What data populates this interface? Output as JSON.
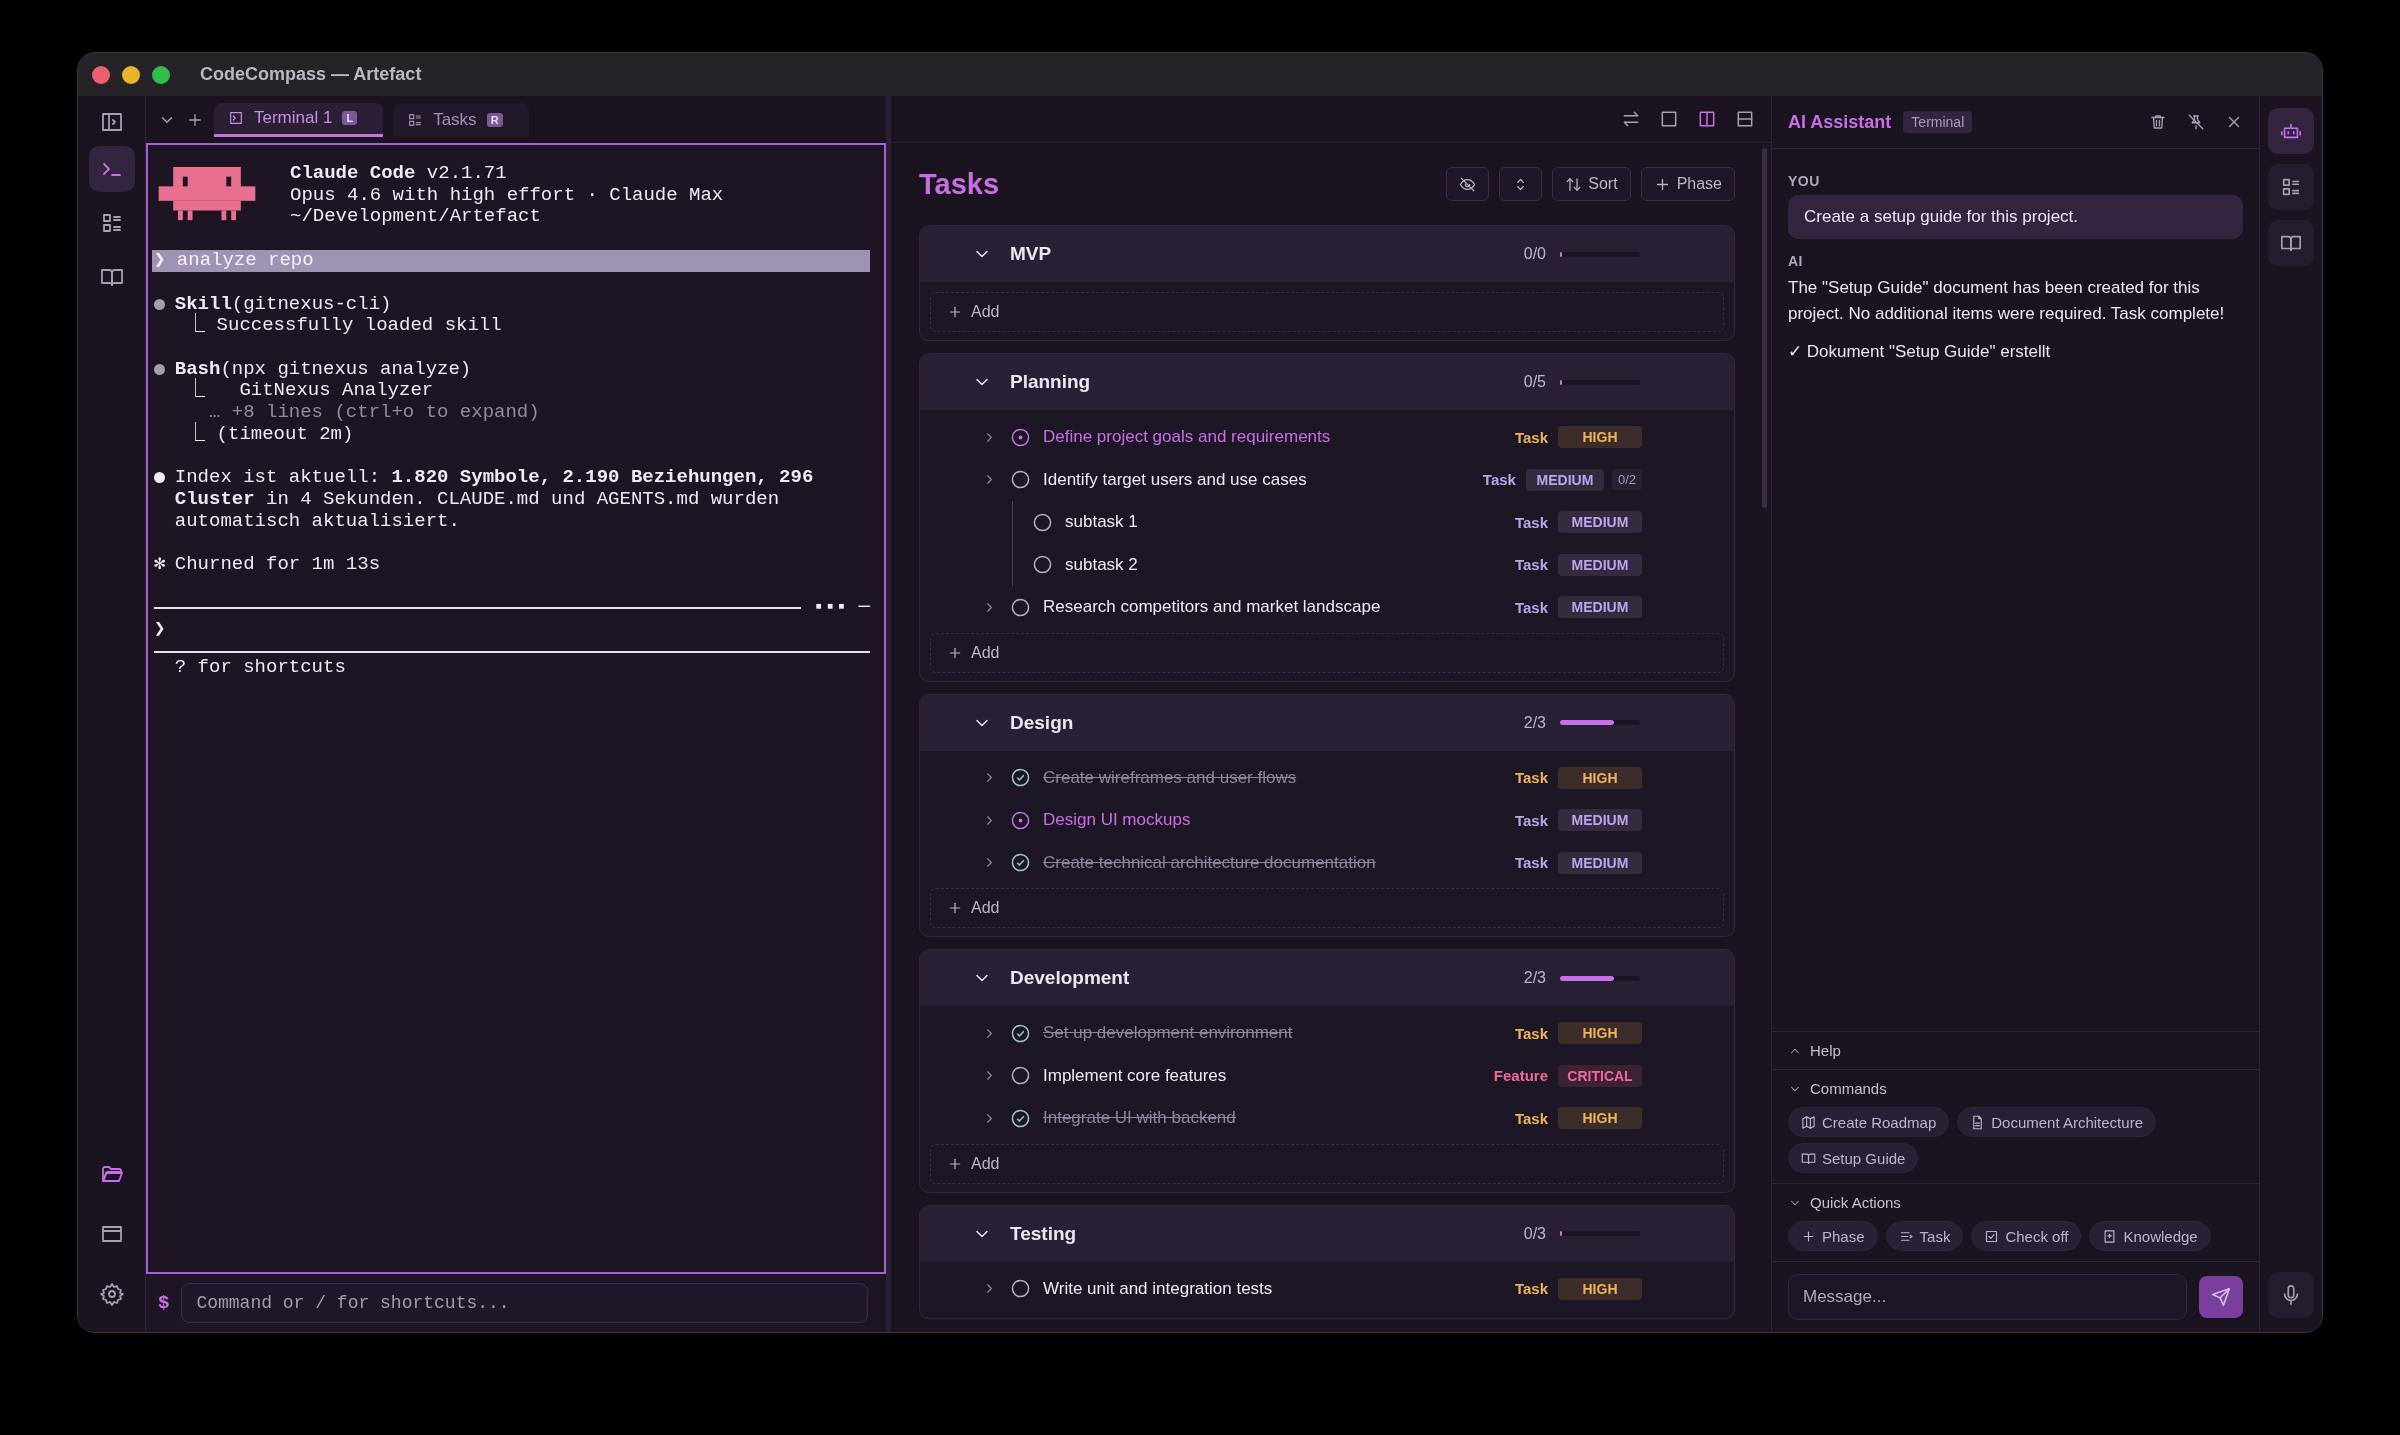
{
  "window": {
    "title": "CodeCompass — Artefact"
  },
  "left_rail": {
    "top": [
      {
        "kind": "terminal",
        "selected": true
      },
      {
        "kind": "list",
        "selected": false
      },
      {
        "kind": "book",
        "selected": false
      }
    ],
    "bottom": [
      {
        "kind": "folder",
        "active": true
      },
      {
        "kind": "window",
        "active": false
      },
      {
        "kind": "settings",
        "active": false
      }
    ]
  },
  "tabs": [
    {
      "kind": "terminal",
      "label": "Terminal 1",
      "badge": "L",
      "selected": true
    },
    {
      "kind": "list",
      "label": "Tasks",
      "badge": "R",
      "selected": false
    }
  ],
  "layout_buttons": [
    {
      "kind": "swap",
      "selected": false
    },
    {
      "kind": "single",
      "selected": false
    },
    {
      "kind": "split",
      "selected": true
    },
    {
      "kind": "rows",
      "selected": false
    }
  ],
  "terminal": {
    "app": "Claude Code",
    "version": "v2.1.71",
    "model": "Opus 4.6 with high effort · Claude Max",
    "path": "~/Development/Artefact",
    "prompt": "❯ analyze repo",
    "blocks": [
      {
        "kind": "bullet",
        "color": "#a39ead",
        "head": "**Skill**(gitnexus-cli)",
        "lines": [
          {
            "kind": "result",
            "text": "⎿ Successfully loaded skill"
          }
        ]
      },
      {
        "kind": "bullet",
        "color": "#a39ead",
        "head": "**Bash**(npx gitnexus analyze)",
        "lines": [
          {
            "kind": "result",
            "text": "⎿   GitNexus Analyzer"
          },
          {
            "kind": "dim",
            "text": "… +8 lines (ctrl+o to expand)"
          },
          {
            "kind": "result",
            "text": "⎿ (timeout 2m)"
          }
        ]
      },
      {
        "kind": "bullet",
        "color": "#f2eef6",
        "head": "Index ist aktuell: **1.820 Symbole, 2.190 Beziehungen, 296 Cluster** in 4 Sekunden. CLAUDE.md und AGENTS.md wurden automatisch aktualisiert."
      },
      {
        "kind": "star",
        "marker": "✻",
        "head": "Churned for 1m 13s"
      }
    ],
    "rule_marker": "▪▪▪ ─",
    "input_caret": "❯",
    "hint": "? for shortcuts"
  },
  "command": {
    "prefix": "$",
    "placeholder": "Command or / for shortcuts..."
  },
  "tasks": {
    "title": "Tasks",
    "toolbar": [
      {
        "kind": "hide"
      },
      {
        "kind": "collapse"
      },
      {
        "kind": "sort",
        "label": "Sort"
      },
      {
        "kind": "add",
        "label": "Phase"
      }
    ],
    "phases": [
      {
        "name": "MVP",
        "count": "0/0",
        "level": 0,
        "expanded": true,
        "add_label": "Add"
      },
      {
        "name": "Planning",
        "count": "0/5",
        "level": 0,
        "expanded": true,
        "add_label": "Add",
        "tasks": [
          {
            "title": "Define project goals and requirements",
            "active": true,
            "done": false,
            "type": "Task",
            "priority": "HIGH",
            "color": "#f0b35a"
          },
          {
            "title": "Identify target users and use cases",
            "active": false,
            "done": false,
            "type": "Task",
            "priority": "MEDIUM",
            "color": "#b9a6ea",
            "subcount": "0/2",
            "children": [
              {
                "title": "subtask 1",
                "active": false,
                "done": false,
                "type": "Task",
                "priority": "MEDIUM",
                "color": "#b9a6ea"
              },
              {
                "title": "subtask 2",
                "active": false,
                "done": false,
                "type": "Task",
                "priority": "MEDIUM",
                "color": "#b9a6ea"
              }
            ]
          },
          {
            "title": "Research competitors and market landscape",
            "active": false,
            "done": false,
            "type": "Task",
            "priority": "MEDIUM",
            "color": "#b9a6ea"
          }
        ]
      },
      {
        "name": "Design",
        "count": "2/3",
        "level": 0.67,
        "expanded": true,
        "add_label": "Add",
        "tasks": [
          {
            "title": "Create wireframes and user flows",
            "active": false,
            "done": true,
            "type": "Task",
            "priority": "HIGH",
            "color": "#f0b35a"
          },
          {
            "title": "Design UI mockups",
            "active": true,
            "done": false,
            "type": "Task",
            "priority": "MEDIUM",
            "color": "#b9a6ea"
          },
          {
            "title": "Create technical architecture documentation",
            "active": false,
            "done": true,
            "type": "Task",
            "priority": "MEDIUM",
            "color": "#b9a6ea"
          }
        ]
      },
      {
        "name": "Development",
        "count": "2/3",
        "level": 0.67,
        "expanded": true,
        "add_label": "Add",
        "tasks": [
          {
            "title": "Set up development environment",
            "active": false,
            "done": true,
            "type": "Task",
            "priority": "HIGH",
            "color": "#f0b35a"
          },
          {
            "title": "Implement core features",
            "active": false,
            "done": false,
            "type": "Feature",
            "priority": "CRITICAL",
            "color": "#ef6b93"
          },
          {
            "title": "Integrate UI with backend",
            "active": false,
            "done": true,
            "type": "Task",
            "priority": "HIGH",
            "color": "#f0b35a"
          }
        ]
      },
      {
        "name": "Testing",
        "count": "0/3",
        "level": 0,
        "expanded": true,
        "tasks": [
          {
            "title": "Write unit and integration tests",
            "active": false,
            "done": false,
            "type": "Task",
            "priority": "HIGH",
            "color": "#f0b35a"
          }
        ]
      }
    ]
  },
  "assistant": {
    "title": "AI Assistant",
    "badge": "Terminal",
    "messages": [
      {
        "kind": "user",
        "role": "YOU",
        "text": "Create a setup guide for this project."
      },
      {
        "kind": "ai",
        "role": "AI",
        "text": "The \"Setup Guide\" document has been created for this project. No additional items were required. Task complete!",
        "notes": [
          "✓ Dokument \"Setup Guide\" erstellt"
        ]
      }
    ],
    "help": {
      "label": "Help",
      "expanded": false
    },
    "sections": [
      {
        "label": "Commands",
        "expanded": true,
        "chips": [
          {
            "kind": "map",
            "label": "Create Roadmap"
          },
          {
            "kind": "doc",
            "label": "Document Architecture"
          },
          {
            "kind": "book",
            "label": "Setup Guide"
          }
        ]
      },
      {
        "label": "Quick Actions",
        "expanded": true,
        "chips": [
          {
            "kind": "add",
            "label": "Phase"
          },
          {
            "kind": "task",
            "label": "Task"
          },
          {
            "kind": "check",
            "label": "Check off"
          },
          {
            "kind": "knowledge",
            "label": "Knowledge"
          }
        ]
      }
    ],
    "input": {
      "placeholder": "Message..."
    }
  },
  "right_rail": [
    {
      "kind": "bot",
      "selected": true
    },
    {
      "kind": "list",
      "selected": false
    },
    {
      "kind": "book",
      "selected": false
    }
  ]
}
